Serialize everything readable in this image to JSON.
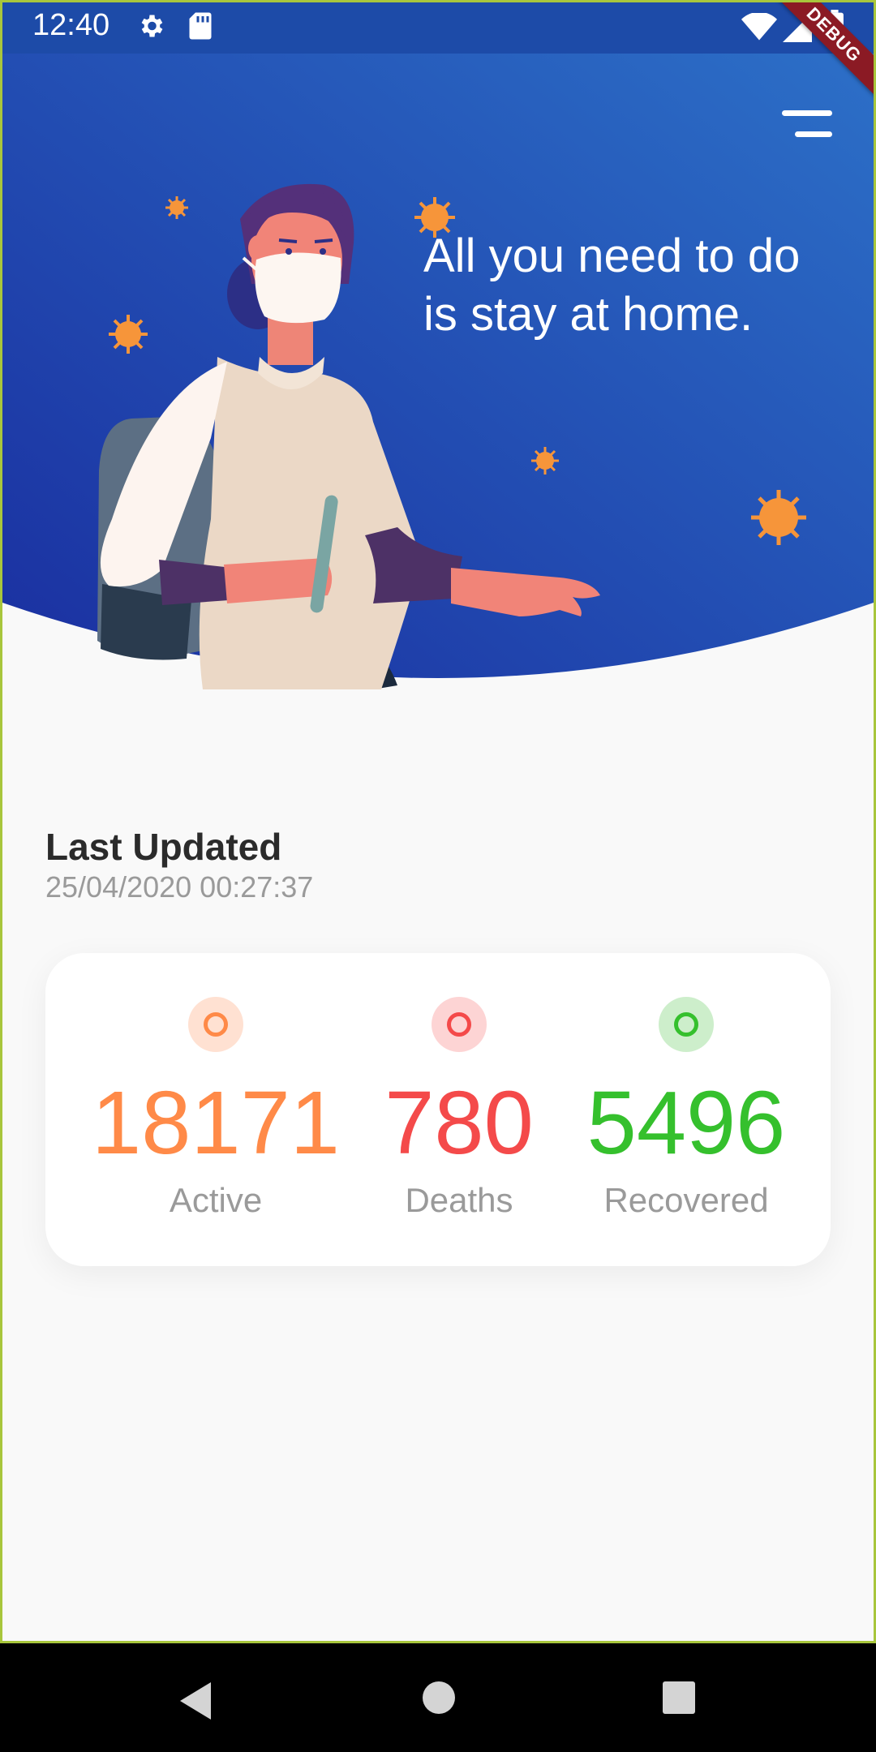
{
  "status_bar": {
    "time": "12:40",
    "icons": [
      "gear-icon",
      "sd-card-icon",
      "wifi-icon",
      "signal-icon",
      "battery-icon"
    ]
  },
  "debug_banner": "DEBUG",
  "header": {
    "headline_line1": "All you need to do",
    "headline_line2": "is stay at home.",
    "menu_icon": "menu-icon",
    "gradient_colors": [
      "#1a2fa0",
      "#2d72c9"
    ]
  },
  "last_updated": {
    "title": "Last Updated",
    "timestamp": "25/04/2020 00:27:37"
  },
  "stats": [
    {
      "id": "active",
      "value": "18171",
      "label": "Active",
      "color": "#ff8a48",
      "bg": "#ffe1d2"
    },
    {
      "id": "deaths",
      "value": "780",
      "label": "Deaths",
      "color": "#f44a4a",
      "bg": "#fdd4d4"
    },
    {
      "id": "recovered",
      "value": "5496",
      "label": "Recovered",
      "color": "#35c02d",
      "bg": "#cdeecb"
    }
  ],
  "nav_bar": {
    "icons": [
      "back-icon",
      "home-icon",
      "recents-icon"
    ]
  }
}
